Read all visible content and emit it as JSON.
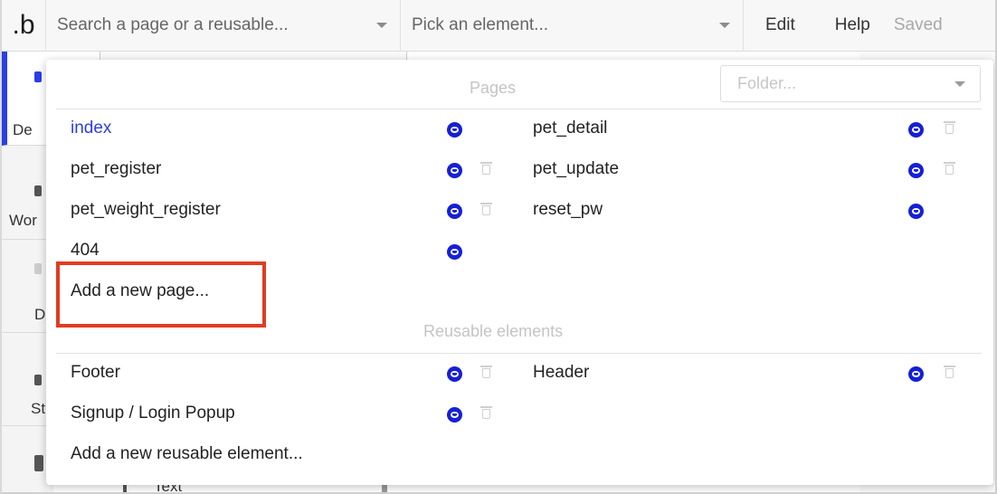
{
  "topbar": {
    "logo": ".b",
    "page_search_placeholder": "Search a page or a reusable...",
    "element_picker_placeholder": "Pick an element...",
    "menu": [
      "Edit",
      "Help"
    ],
    "status": "Saved"
  },
  "sidebar": {
    "tabs": [
      "De",
      "Wor",
      "D",
      "St"
    ]
  },
  "background": {
    "text_fragment": "Text"
  },
  "panel": {
    "pages_title": "Pages",
    "folder_placeholder": "Folder...",
    "pages_left": [
      {
        "name": "index",
        "current": true
      },
      {
        "name": "pet_register"
      },
      {
        "name": "pet_weight_register"
      },
      {
        "name": "404"
      }
    ],
    "pages_right": [
      {
        "name": "pet_detail"
      },
      {
        "name": "pet_update"
      },
      {
        "name": "reset_pw"
      }
    ],
    "add_page": "Add a new page...",
    "reusable_title": "Reusable elements",
    "reusable_left": [
      {
        "name": "Footer"
      },
      {
        "name": "Signup / Login Popup"
      }
    ],
    "reusable_right": [
      {
        "name": "Header"
      }
    ],
    "add_reusable": "Add a new reusable element..."
  },
  "colors": {
    "accent": "#2b3ee6",
    "clone_icon": "#1520d6",
    "highlight": "#e03c22"
  }
}
